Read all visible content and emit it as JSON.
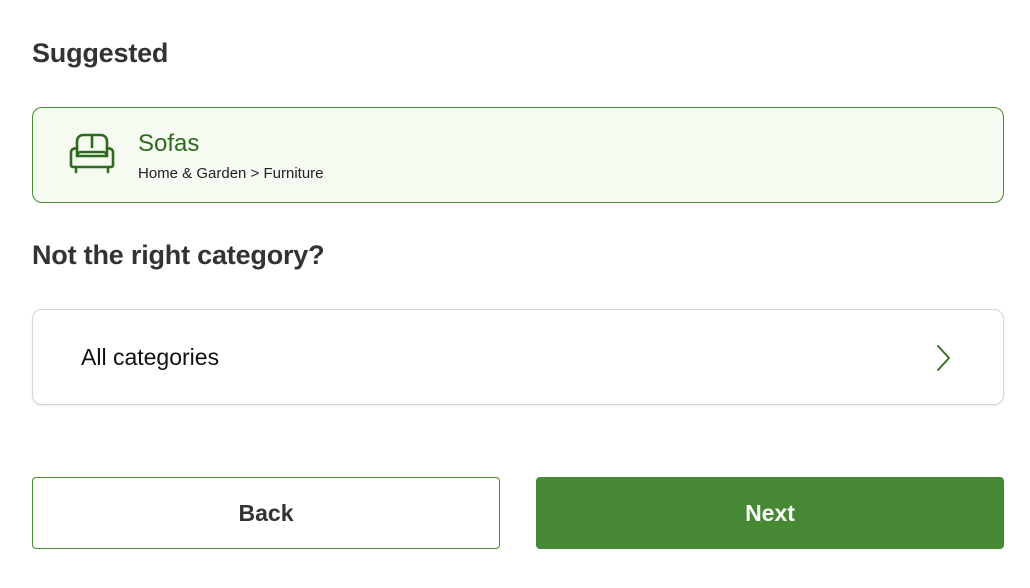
{
  "suggested": {
    "heading": "Suggested",
    "card": {
      "icon": "sofa-icon",
      "title": "Sofas",
      "path": "Home & Garden > Furniture"
    }
  },
  "alternatives": {
    "heading": "Not the right category?",
    "all_categories_label": "All categories",
    "chevron_icon": "chevron-right-icon"
  },
  "actions": {
    "back_label": "Back",
    "next_label": "Next"
  },
  "colors": {
    "accent_green": "#468834",
    "title_green": "#2e6a1d",
    "card_background": "#f6fbf1",
    "heading_text": "#333333"
  }
}
